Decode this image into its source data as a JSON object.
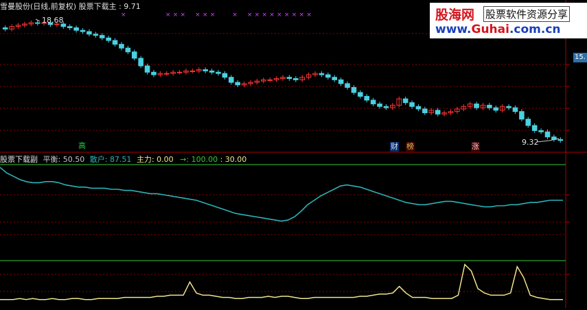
{
  "header": {
    "stock_name": "雪曼股份(日线,前复权)",
    "main_indicator_label": "股票下载主",
    "main_indicator_value": ": 9.71",
    "sub_indicator_label": "股票下载副",
    "ping_heng_label": "平衡:",
    "ping_heng_value": "50.50",
    "san_hu_label": "散户:",
    "san_hu_value": "87.51",
    "zhu_li_label": "主力:",
    "zhu_li_value": "0.00",
    "arrow_label": "→:",
    "arrow_value": "100.00",
    "extra_value": ": 30.00"
  },
  "watermark": {
    "logo": "股海网",
    "tagline": "股票软件资源分享",
    "url_prefix": "www.",
    "url_brand": "Guhai",
    "url_suffix": ".com.cn"
  },
  "price_axis_tag": "15.",
  "annotations": {
    "high_price": "18.68",
    "low_price": "9.32",
    "marker_high": "高",
    "marker_cai": "财",
    "marker_bang": "榜",
    "marker_zhang": "涨"
  },
  "colors": {
    "up_candle": "#ff3333",
    "down_candle": "#4ad0e0",
    "grid": "#8b0000",
    "sub_line": "#2bb3b8",
    "bottom_line": "#f0e68c",
    "level_line": "#33cc33",
    "x_marker": "#cc44ff"
  },
  "chart_data": [
    {
      "type": "candlestick",
      "title": "雪曼股份(日线,前复权)",
      "ylim": [
        8.5,
        19.2
      ],
      "closes": [
        18.1,
        18.3,
        18.4,
        18.5,
        18.6,
        18.55,
        18.6,
        18.45,
        18.5,
        18.3,
        18.2,
        18.0,
        17.9,
        17.7,
        17.6,
        17.4,
        17.2,
        16.9,
        16.6,
        16.3,
        15.8,
        15.2,
        14.7,
        14.5,
        14.6,
        14.6,
        14.7,
        14.7,
        14.8,
        14.8,
        14.9,
        14.8,
        14.7,
        14.6,
        14.3,
        13.9,
        13.7,
        13.8,
        13.9,
        14.0,
        14.1,
        14.1,
        14.2,
        14.3,
        14.2,
        14.1,
        14.3,
        14.5,
        14.6,
        14.5,
        14.3,
        14.1,
        13.8,
        13.5,
        13.1,
        12.8,
        12.5,
        12.2,
        12.0,
        11.9,
        12.1,
        12.6,
        12.3,
        12.0,
        11.8,
        11.5,
        11.7,
        11.4,
        11.5,
        11.6,
        11.8,
        12.0,
        12.2,
        11.9,
        12.1,
        11.9,
        11.7,
        12.0,
        11.9,
        11.6,
        11.0,
        10.5,
        10.1,
        10.0,
        9.6,
        9.4,
        9.32
      ],
      "x_marker_columns": [
        16,
        22,
        23,
        24,
        26,
        27,
        28,
        31,
        33,
        34,
        35,
        36,
        37,
        38,
        39,
        40,
        41
      ]
    },
    {
      "type": "line",
      "series": [
        {
          "name": "散户",
          "values": [
            100,
            95,
            92,
            89,
            87,
            86,
            86,
            87,
            87,
            86,
            84,
            83,
            82,
            82,
            81,
            81,
            81,
            80,
            80,
            79,
            79,
            78,
            77,
            76,
            76,
            75,
            74,
            73,
            72,
            71,
            70,
            68,
            66,
            64,
            62,
            60,
            58,
            57,
            56,
            55,
            54,
            53,
            52,
            51,
            52,
            55,
            60,
            66,
            70,
            74,
            77,
            80,
            83,
            84,
            83,
            82,
            80,
            78,
            76,
            74,
            72,
            70,
            68,
            67,
            66,
            66,
            67,
            68,
            69,
            69,
            68,
            67,
            66,
            65,
            64,
            64,
            65,
            65,
            66,
            66,
            67,
            68,
            68,
            69,
            70,
            70,
            70
          ]
        },
        {
          "name": "主力",
          "values": [
            2,
            2,
            2,
            3,
            2,
            3,
            2,
            2,
            3,
            2,
            2,
            3,
            3,
            2,
            2,
            3,
            3,
            3,
            3,
            4,
            4,
            4,
            4,
            4,
            5,
            5,
            6,
            6,
            6,
            18,
            8,
            6,
            6,
            5,
            4,
            4,
            3,
            3,
            4,
            4,
            4,
            5,
            4,
            5,
            5,
            4,
            3,
            3,
            4,
            4,
            4,
            4,
            4,
            4,
            4,
            5,
            5,
            6,
            7,
            7,
            8,
            14,
            8,
            4,
            4,
            4,
            3,
            3,
            3,
            3,
            6,
            34,
            28,
            12,
            8,
            6,
            6,
            6,
            8,
            32,
            22,
            6,
            4,
            3,
            2,
            2,
            2
          ]
        }
      ],
      "levels": [
        100,
        30
      ],
      "ylim": [
        0,
        100
      ]
    }
  ]
}
